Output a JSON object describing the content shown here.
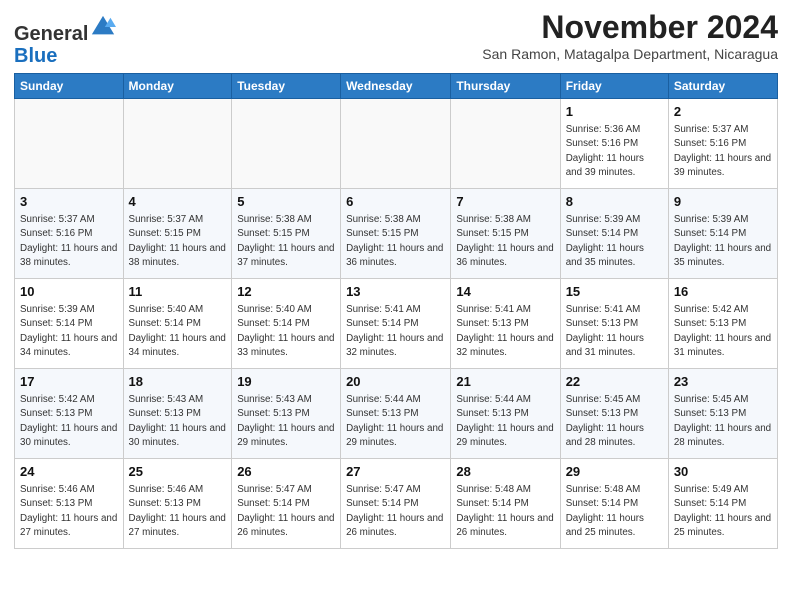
{
  "logo": {
    "general": "General",
    "blue": "Blue"
  },
  "header": {
    "month_year": "November 2024",
    "location": "San Ramon, Matagalpa Department, Nicaragua"
  },
  "weekdays": [
    "Sunday",
    "Monday",
    "Tuesday",
    "Wednesday",
    "Thursday",
    "Friday",
    "Saturday"
  ],
  "weeks": [
    [
      {
        "day": "",
        "info": ""
      },
      {
        "day": "",
        "info": ""
      },
      {
        "day": "",
        "info": ""
      },
      {
        "day": "",
        "info": ""
      },
      {
        "day": "",
        "info": ""
      },
      {
        "day": "1",
        "info": "Sunrise: 5:36 AM\nSunset: 5:16 PM\nDaylight: 11 hours\nand 39 minutes."
      },
      {
        "day": "2",
        "info": "Sunrise: 5:37 AM\nSunset: 5:16 PM\nDaylight: 11 hours\nand 39 minutes."
      }
    ],
    [
      {
        "day": "3",
        "info": "Sunrise: 5:37 AM\nSunset: 5:16 PM\nDaylight: 11 hours\nand 38 minutes."
      },
      {
        "day": "4",
        "info": "Sunrise: 5:37 AM\nSunset: 5:15 PM\nDaylight: 11 hours\nand 38 minutes."
      },
      {
        "day": "5",
        "info": "Sunrise: 5:38 AM\nSunset: 5:15 PM\nDaylight: 11 hours\nand 37 minutes."
      },
      {
        "day": "6",
        "info": "Sunrise: 5:38 AM\nSunset: 5:15 PM\nDaylight: 11 hours\nand 36 minutes."
      },
      {
        "day": "7",
        "info": "Sunrise: 5:38 AM\nSunset: 5:15 PM\nDaylight: 11 hours\nand 36 minutes."
      },
      {
        "day": "8",
        "info": "Sunrise: 5:39 AM\nSunset: 5:14 PM\nDaylight: 11 hours\nand 35 minutes."
      },
      {
        "day": "9",
        "info": "Sunrise: 5:39 AM\nSunset: 5:14 PM\nDaylight: 11 hours\nand 35 minutes."
      }
    ],
    [
      {
        "day": "10",
        "info": "Sunrise: 5:39 AM\nSunset: 5:14 PM\nDaylight: 11 hours\nand 34 minutes."
      },
      {
        "day": "11",
        "info": "Sunrise: 5:40 AM\nSunset: 5:14 PM\nDaylight: 11 hours\nand 34 minutes."
      },
      {
        "day": "12",
        "info": "Sunrise: 5:40 AM\nSunset: 5:14 PM\nDaylight: 11 hours\nand 33 minutes."
      },
      {
        "day": "13",
        "info": "Sunrise: 5:41 AM\nSunset: 5:14 PM\nDaylight: 11 hours\nand 32 minutes."
      },
      {
        "day": "14",
        "info": "Sunrise: 5:41 AM\nSunset: 5:13 PM\nDaylight: 11 hours\nand 32 minutes."
      },
      {
        "day": "15",
        "info": "Sunrise: 5:41 AM\nSunset: 5:13 PM\nDaylight: 11 hours\nand 31 minutes."
      },
      {
        "day": "16",
        "info": "Sunrise: 5:42 AM\nSunset: 5:13 PM\nDaylight: 11 hours\nand 31 minutes."
      }
    ],
    [
      {
        "day": "17",
        "info": "Sunrise: 5:42 AM\nSunset: 5:13 PM\nDaylight: 11 hours\nand 30 minutes."
      },
      {
        "day": "18",
        "info": "Sunrise: 5:43 AM\nSunset: 5:13 PM\nDaylight: 11 hours\nand 30 minutes."
      },
      {
        "day": "19",
        "info": "Sunrise: 5:43 AM\nSunset: 5:13 PM\nDaylight: 11 hours\nand 29 minutes."
      },
      {
        "day": "20",
        "info": "Sunrise: 5:44 AM\nSunset: 5:13 PM\nDaylight: 11 hours\nand 29 minutes."
      },
      {
        "day": "21",
        "info": "Sunrise: 5:44 AM\nSunset: 5:13 PM\nDaylight: 11 hours\nand 29 minutes."
      },
      {
        "day": "22",
        "info": "Sunrise: 5:45 AM\nSunset: 5:13 PM\nDaylight: 11 hours\nand 28 minutes."
      },
      {
        "day": "23",
        "info": "Sunrise: 5:45 AM\nSunset: 5:13 PM\nDaylight: 11 hours\nand 28 minutes."
      }
    ],
    [
      {
        "day": "24",
        "info": "Sunrise: 5:46 AM\nSunset: 5:13 PM\nDaylight: 11 hours\nand 27 minutes."
      },
      {
        "day": "25",
        "info": "Sunrise: 5:46 AM\nSunset: 5:13 PM\nDaylight: 11 hours\nand 27 minutes."
      },
      {
        "day": "26",
        "info": "Sunrise: 5:47 AM\nSunset: 5:14 PM\nDaylight: 11 hours\nand 26 minutes."
      },
      {
        "day": "27",
        "info": "Sunrise: 5:47 AM\nSunset: 5:14 PM\nDaylight: 11 hours\nand 26 minutes."
      },
      {
        "day": "28",
        "info": "Sunrise: 5:48 AM\nSunset: 5:14 PM\nDaylight: 11 hours\nand 26 minutes."
      },
      {
        "day": "29",
        "info": "Sunrise: 5:48 AM\nSunset: 5:14 PM\nDaylight: 11 hours\nand 25 minutes."
      },
      {
        "day": "30",
        "info": "Sunrise: 5:49 AM\nSunset: 5:14 PM\nDaylight: 11 hours\nand 25 minutes."
      }
    ]
  ]
}
